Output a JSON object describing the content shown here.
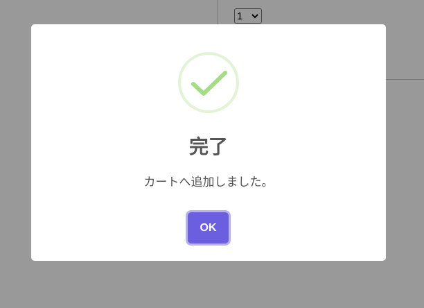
{
  "background_page": {
    "quantity_select": {
      "selected_value": "1"
    }
  },
  "dialog": {
    "icon": "success-checkmark-icon",
    "title": "完了",
    "message": "カートへ追加しました。",
    "confirm_button_label": "OK"
  },
  "colors": {
    "overlay": "rgba(0,0,0,0.4)",
    "success_ring": "#e3f3d6",
    "success_check": "#a5dc86",
    "confirm_button": "#6b5fe0",
    "text": "#545454"
  }
}
